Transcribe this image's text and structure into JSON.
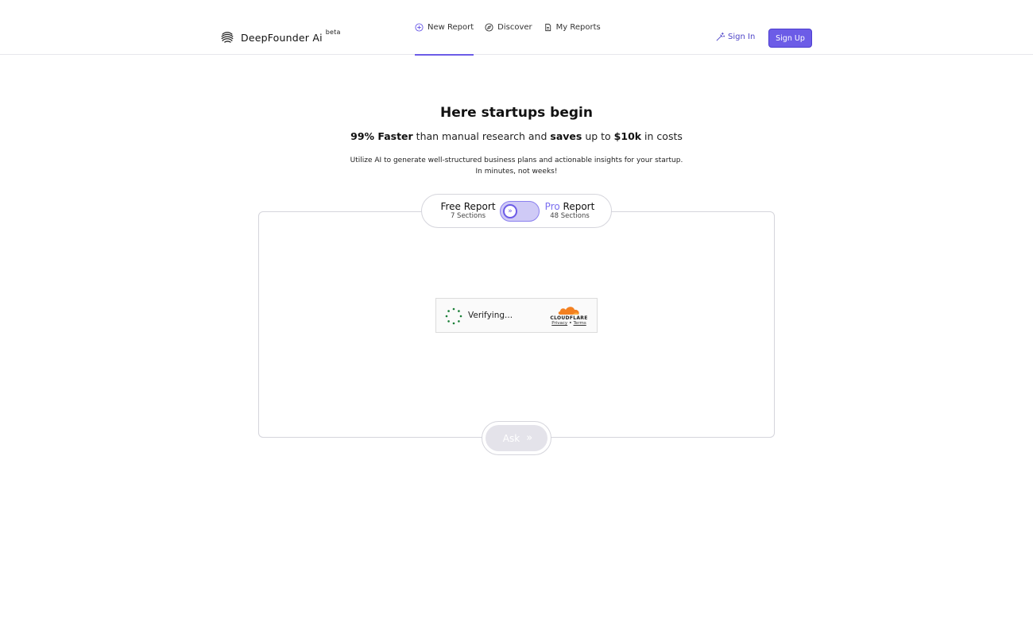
{
  "brand": {
    "name": "DeepFounder Ai",
    "badge": "beta"
  },
  "nav": {
    "items": [
      {
        "label": "New Report",
        "icon": "plus-circle-icon",
        "active": true
      },
      {
        "label": "Discover",
        "icon": "compass-icon",
        "active": false
      },
      {
        "label": "My Reports",
        "icon": "document-icon",
        "active": false
      }
    ]
  },
  "auth": {
    "sign_in": "Sign In",
    "sign_up": "Sign Up"
  },
  "hero": {
    "title": "Here startups begin",
    "sub_bold_1": "99% Faster",
    "sub_text_1": " than manual research and ",
    "sub_bold_2": "saves",
    "sub_text_2": " up to ",
    "sub_bold_3": "$10k",
    "sub_text_3": " in costs",
    "desc_line_1": "Utilize AI to generate well-structured business plans and actionable insights for your startup.",
    "desc_line_2": "In minutes, not weeks!"
  },
  "toggle": {
    "free_title": "Free Report",
    "free_sub": "7 Sections",
    "pro_word": "Pro",
    "pro_title_rest": " Report",
    "pro_sub": "48 Sections",
    "knob_glyph": "»"
  },
  "captcha": {
    "status": "Verifying...",
    "brand": "CLOUDFLARE",
    "privacy": "Privacy",
    "separator": " • ",
    "terms": "Terms"
  },
  "ask": {
    "label": "Ask",
    "arrows": "»"
  },
  "colors": {
    "accent": "#6c5ce7",
    "cloudflare_orange": "#f38020",
    "spinner_green": "#1a7f37"
  }
}
